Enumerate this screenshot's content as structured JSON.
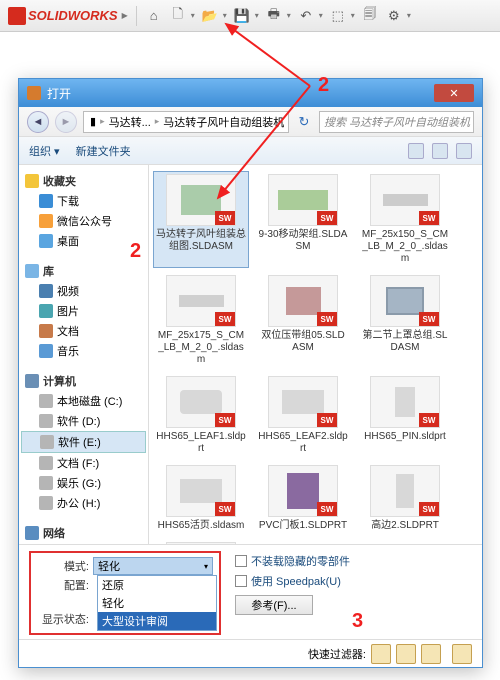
{
  "app": {
    "name": "SOLIDWORKS"
  },
  "dialog": {
    "title": "打开",
    "breadcrumb": [
      "马达转...",
      "马达转子风叶自动组装机"
    ],
    "search_placeholder": "搜索 马达转子风叶自动组装机",
    "toolbar": {
      "organize": "组织 ▾",
      "newfolder": "新建文件夹"
    }
  },
  "tree": {
    "favorites": {
      "label": "收藏夹",
      "items": [
        "下载",
        "微信公众号",
        "桌面"
      ]
    },
    "library": {
      "label": "库",
      "items": [
        "视频",
        "图片",
        "文档",
        "音乐"
      ]
    },
    "computer": {
      "label": "计算机",
      "items": [
        "本地磁盘 (C:)",
        "软件 (D:)",
        "软件 (E:)",
        "文档 (F:)",
        "娱乐 (G:)",
        "办公 (H:)"
      ]
    },
    "network": {
      "label": "网络"
    }
  },
  "files": [
    {
      "name": "马达转子风叶组装总组图.SLDASM"
    },
    {
      "name": "9-30移动架组.SLDASM"
    },
    {
      "name": "MF_25x150_S_CM_LB_M_2_0_.sldasm"
    },
    {
      "name": "MF_25x175_S_CM_LB_M_2_0_.sldasm"
    },
    {
      "name": "双位压带组05.SLDASM"
    },
    {
      "name": "第二节上罩总组.SLDASM"
    },
    {
      "name": "HHS65_LEAF1.sldprt"
    },
    {
      "name": "HHS65_LEAF2.sldprt"
    },
    {
      "name": "HHS65_PIN.sldprt"
    },
    {
      "name": "HHS65活页.sldasm"
    },
    {
      "name": "PVC门板1.SLDPRT"
    },
    {
      "name": "高边2.SLDPRT"
    },
    {
      "name": ""
    }
  ],
  "mode": {
    "label_mode": "模式:",
    "label_config": "配置:",
    "label_display": "显示状态:",
    "selected": "轻化",
    "options": [
      "还原",
      "轻化",
      "大型设计审阅"
    ],
    "chk_hidden": "不装载隐藏的零部件",
    "chk_speedpak": "使用 Speedpak(U)",
    "ref_btn": "参考(F)..."
  },
  "quickfilter_label": "快速过滤器:",
  "annotations": {
    "top": "2",
    "tree": "2",
    "bottom": "3"
  }
}
